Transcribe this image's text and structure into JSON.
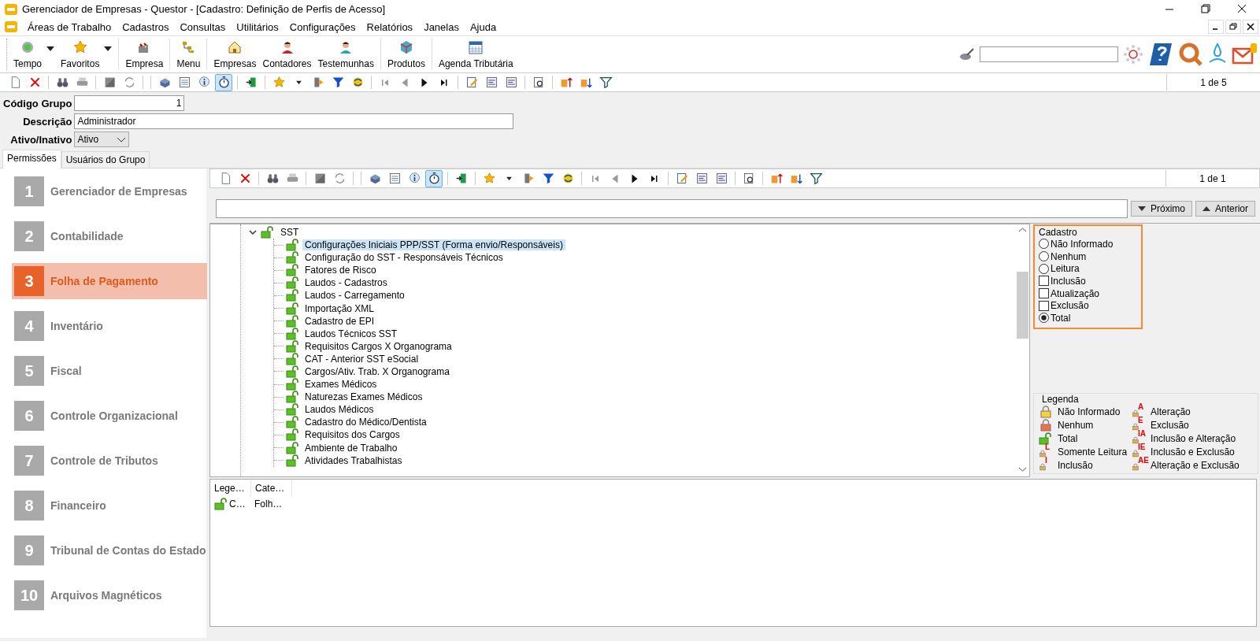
{
  "window": {
    "title": "Gerenciador de Empresas - Questor - [Cadastro: Definição de Perfis de Acesso]"
  },
  "menu": [
    "Áreas de Trabalho",
    "Cadastros",
    "Consultas",
    "Utilitários",
    "Configurações",
    "Relatórios",
    "Janelas",
    "Ajuda"
  ],
  "main_toolbar": [
    [
      {
        "label": "Tempo",
        "dropdown": true
      },
      {
        "label": "Favoritos",
        "dropdown": true
      }
    ],
    [
      {
        "label": "Empresa",
        "dropdown": false
      }
    ],
    [
      {
        "label": "Menu",
        "dropdown": false
      }
    ],
    [
      {
        "label": "Empresas",
        "dropdown": false
      },
      {
        "label": "Contadores",
        "dropdown": false
      },
      {
        "label": "Testemunhas",
        "dropdown": false
      }
    ],
    [
      {
        "label": "Produtos",
        "dropdown": false
      }
    ],
    [
      {
        "label": "Agenda Tributária",
        "dropdown": false
      }
    ]
  ],
  "record_toolbar": {
    "position": "1 de 5",
    "timer_on": true
  },
  "form": {
    "fields": [
      {
        "label": "Código Grupo",
        "value": "1",
        "kind": "number"
      },
      {
        "label": "Descrição",
        "value": "Administrador",
        "kind": "text"
      },
      {
        "label": "Ativo/Inativo",
        "value": "Ativo",
        "kind": "select"
      }
    ]
  },
  "tabs": [
    {
      "label": "Permissões",
      "selected": true
    },
    {
      "label": "Usuários do Grupo",
      "selected": false
    }
  ],
  "modules": [
    {
      "number": "1",
      "label": "Gerenciador de Empresas",
      "selected": false
    },
    {
      "number": "2",
      "label": "Contabilidade",
      "selected": false
    },
    {
      "number": "3",
      "label": "Folha de Pagamento",
      "selected": true
    },
    {
      "number": "4",
      "label": "Inventário",
      "selected": false
    },
    {
      "number": "5",
      "label": "Fiscal",
      "selected": false
    },
    {
      "number": "6",
      "label": "Controle Organizacional",
      "selected": false
    },
    {
      "number": "7",
      "label": "Controle de Tributos",
      "selected": false
    },
    {
      "number": "8",
      "label": "Financeiro",
      "selected": false
    },
    {
      "number": "9",
      "label": "Tribunal de Contas do Estado",
      "selected": false
    },
    {
      "number": "10",
      "label": "Arquivos Magnéticos",
      "selected": false
    }
  ],
  "inner_toolbar": {
    "position": "1 de 1",
    "timer_on": true
  },
  "find": {
    "buttons": [
      "Próximo",
      "Anterior"
    ]
  },
  "tree": {
    "label": "SST",
    "expanded": true,
    "children": [
      {
        "label": "Configurações Iniciais PPP/SST (Forma envio/Responsáveis)",
        "selected": true
      },
      {
        "label": "Configuração do SST - Responsáveis Técnicos",
        "selected": false
      },
      {
        "label": "Fatores de Risco",
        "selected": false
      },
      {
        "label": "Laudos - Cadastros",
        "selected": false
      },
      {
        "label": "Laudos - Carregamento",
        "selected": false
      },
      {
        "label": "Importação XML",
        "selected": false
      },
      {
        "label": "Cadastro de EPI",
        "selected": false
      },
      {
        "label": "Laudos Técnicos SST",
        "selected": false
      },
      {
        "label": "Requisitos Cargos X Organograma",
        "selected": false
      },
      {
        "label": "CAT - Anterior SST eSocial",
        "selected": false
      },
      {
        "label": "Cargos/Ativ. Trab. X Organograma",
        "selected": false
      },
      {
        "label": "Exames Médicos",
        "selected": false
      },
      {
        "label": "Naturezas Exames Médicos",
        "selected": false
      },
      {
        "label": "Laudos Médicos",
        "selected": false
      },
      {
        "label": "Cadastro do Médico/Dentista",
        "selected": false
      },
      {
        "label": "Requisitos dos Cargos",
        "selected": false
      },
      {
        "label": "Ambiente de Trabalho",
        "selected": false
      },
      {
        "label": "Atividades Trabalhistas",
        "selected": false
      }
    ]
  },
  "cadastro": {
    "title": "Cadastro",
    "options": [
      {
        "kind": "radio",
        "label": "Não Informado",
        "checked": false
      },
      {
        "kind": "radio",
        "label": "Nenhum",
        "checked": false
      },
      {
        "kind": "radio",
        "label": "Leitura",
        "checked": false
      },
      {
        "kind": "checkbox",
        "label": "Inclusão",
        "checked": false
      },
      {
        "kind": "checkbox",
        "label": "Atualização",
        "checked": false
      },
      {
        "kind": "checkbox",
        "label": "Exclusão",
        "checked": false
      },
      {
        "kind": "radio",
        "label": "Total",
        "checked": true
      }
    ]
  },
  "legend": {
    "title": "Legenda",
    "columns": [
      [
        {
          "kind": "unset",
          "label": "Não Informado"
        },
        {
          "kind": "denied",
          "label": "Nenhum"
        },
        {
          "kind": "open",
          "label": "Total"
        },
        {
          "kind": "partial",
          "badge": "L",
          "label": "Somente Leitura"
        },
        {
          "kind": "partial",
          "badge": "I",
          "label": "Inclusão"
        }
      ],
      [
        {
          "kind": "partial",
          "badge": "A",
          "label": "Alteração"
        },
        {
          "kind": "partial",
          "badge": "E",
          "label": "Exclusão"
        },
        {
          "kind": "partial",
          "badge": "IA",
          "label": "Inclusão e Alteração"
        },
        {
          "kind": "partial",
          "badge": "IE",
          "label": "Inclusão e Exclusão"
        },
        {
          "kind": "partial",
          "badge": "AE",
          "label": "Alteração e Exclusão"
        }
      ]
    ]
  },
  "grid": {
    "columns": [
      "Lege…",
      "Cate…"
    ],
    "rows": [
      {
        "cells": [
          "C…",
          "Folh…"
        ]
      }
    ]
  }
}
